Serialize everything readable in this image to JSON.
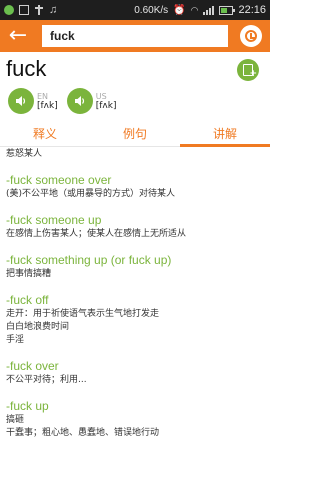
{
  "status_bar": {
    "speed": "0.60K/s",
    "time": "22:16",
    "battery_level": 0.6,
    "icons": [
      "notification-icon",
      "app-icon",
      "usb-icon",
      "music-icon",
      "alarm-icon",
      "wifi-icon",
      "signal-icon",
      "battery-icon"
    ]
  },
  "search": {
    "query": "fuck"
  },
  "word": {
    "headword": "fuck",
    "pron_en_label": "EN",
    "pron_en_ipa": "[fʌk]",
    "pron_us_label": "US",
    "pron_us_ipa": "[fʌk]"
  },
  "tabs": [
    {
      "label": "释义"
    },
    {
      "label": "例句"
    },
    {
      "label": "讲解"
    }
  ],
  "active_tab": 2,
  "content": {
    "top_cut": "惹怒某人",
    "entries": [
      {
        "phrase": "-fuck someone over",
        "lines": [
          "(美)不公平地（或用暴导的方式）对待某人"
        ]
      },
      {
        "phrase": "-fuck someone up",
        "lines": [
          "在感情上伤害某人；使某人在感情上无所适从"
        ]
      },
      {
        "phrase": "-fuck something up (or fuck up)",
        "lines": [
          "把事情搞糟"
        ]
      },
      {
        "phrase": "-fuck off",
        "lines": [
          "走开：用于祈使语气表示生气地打发走",
          "白白地浪费时间",
          "手淫"
        ]
      },
      {
        "phrase": "-fuck over",
        "lines": [
          "不公平对待；利用..."
        ]
      },
      {
        "phrase": "-fuck up",
        "lines": [
          "搞砸",
          "干蠢事；粗心地、愚蠢地、错误地行动"
        ]
      }
    ]
  },
  "colors": {
    "accent": "#f07a22",
    "green": "#7bb43c"
  }
}
